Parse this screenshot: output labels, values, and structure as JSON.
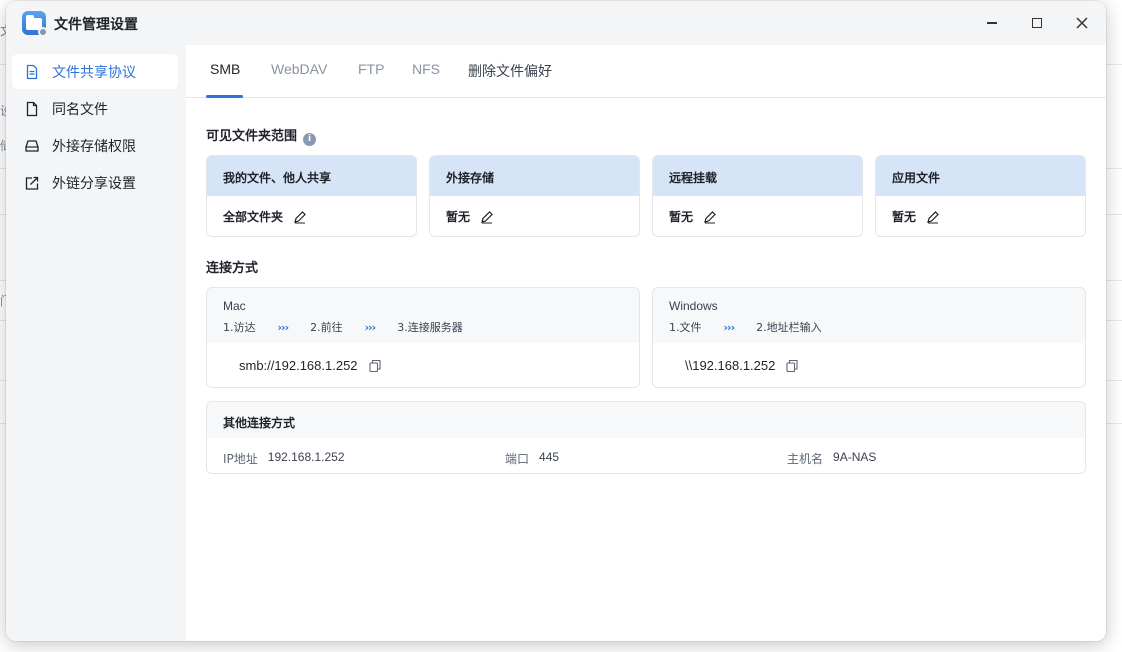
{
  "window": {
    "title": "文件管理设置"
  },
  "background": {
    "fragments": [
      "文",
      "设",
      "储",
      "门"
    ]
  },
  "sidebar": {
    "items": [
      {
        "label": "文件共享协议",
        "icon": "document-icon",
        "active": true
      },
      {
        "label": "同名文件",
        "icon": "file-icon",
        "active": false
      },
      {
        "label": "外接存储权限",
        "icon": "drive-icon",
        "active": false
      },
      {
        "label": "外链分享设置",
        "icon": "share-link-icon",
        "active": false
      }
    ]
  },
  "tabs": [
    {
      "label": "SMB",
      "active": true
    },
    {
      "label": "WebDAV",
      "active": false
    },
    {
      "label": "FTP",
      "active": false
    },
    {
      "label": "NFS",
      "active": false
    },
    {
      "label": "删除文件偏好",
      "active": false
    }
  ],
  "visible_scope": {
    "title": "可见文件夹范围",
    "info_icon": "i",
    "cards": [
      {
        "header": "我的文件、他人共享",
        "value": "全部文件夹"
      },
      {
        "header": "外接存储",
        "value": "暂无"
      },
      {
        "header": "远程挂载",
        "value": "暂无"
      },
      {
        "header": "应用文件",
        "value": "暂无"
      }
    ]
  },
  "connection": {
    "title": "连接方式",
    "mac": {
      "os": "Mac",
      "steps": [
        "1.访达",
        "2.前往",
        "3.连接服务器"
      ],
      "address": "smb://192.168.1.252"
    },
    "windows": {
      "os": "Windows",
      "steps": [
        "1.文件",
        "2.地址栏输入"
      ],
      "address": "\\\\192.168.1.252"
    },
    "arrow": "›››",
    "other": {
      "title": "其他连接方式",
      "ip_label": "IP地址",
      "ip_value": "192.168.1.252",
      "port_label": "端口",
      "port_value": "445",
      "host_label": "主机名",
      "host_value": "9A-NAS"
    }
  },
  "colors": {
    "accent": "#2f72d8",
    "card_header": "#d6e4f7",
    "sidebar_bg": "#f4f5f7"
  }
}
